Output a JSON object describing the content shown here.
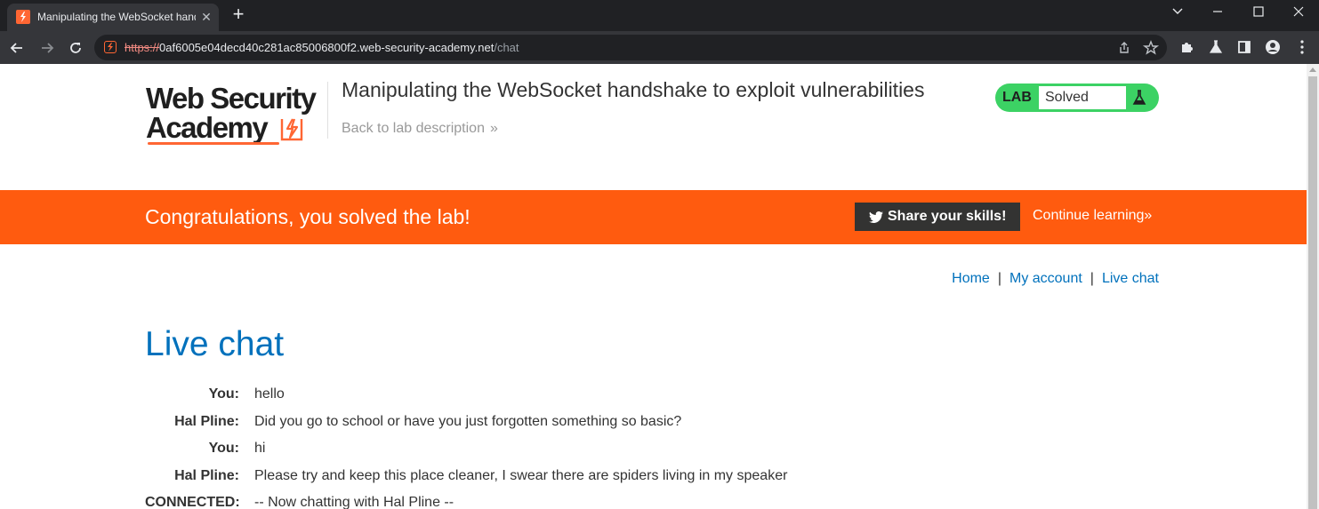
{
  "browser": {
    "tab_title": "Manipulating the WebSocket handshake to exploit vulnerabilities",
    "new_tab": "+",
    "url_scheme": "https://",
    "url_host": "0af6005e04decd40c281ac85006800f2.web-security-academy.net",
    "url_path": "/chat"
  },
  "header": {
    "logo_line1": "Web Security",
    "logo_line2": "Academy",
    "lab_title": "Manipulating the WebSocket handshake to exploit vulnerabilities",
    "back_link": "Back to lab description",
    "back_link_icon": "»",
    "lab_status": {
      "tag": "LAB",
      "value": "Solved",
      "color": "#3cd264"
    }
  },
  "banner": {
    "message": "Congratulations, you solved the lab!",
    "share_label": "Share your skills!",
    "continue_label": "Continue learning",
    "continue_icon": "»",
    "color": "#ff5b0f"
  },
  "nav": {
    "links": [
      "Home",
      "My account",
      "Live chat"
    ],
    "separator": "|"
  },
  "main": {
    "heading": "Live chat",
    "messages": [
      {
        "who": "You:",
        "text": "hello"
      },
      {
        "who": "Hal Pline:",
        "text": "Did you go to school or have you just forgotten something so basic?"
      },
      {
        "who": "You:",
        "text": "hi"
      },
      {
        "who": "Hal Pline:",
        "text": "Please try and keep this place cleaner, I swear there are spiders living in my speaker"
      },
      {
        "who": "CONNECTED:",
        "text": "-- Now chatting with Hal Pline --"
      }
    ]
  },
  "icons": {
    "tab_favicon": "web-security-academy-icon",
    "back": "arrow-left-icon",
    "forward": "arrow-right-icon",
    "reload": "reload-icon",
    "share": "share-icon",
    "bookmark": "star-icon",
    "extensions": "puzzle-icon",
    "labs": "flask-icon",
    "side_panel": "side-panel-icon",
    "profile": "person-icon",
    "menu": "kebab-menu-icon",
    "twitter": "twitter-icon"
  }
}
